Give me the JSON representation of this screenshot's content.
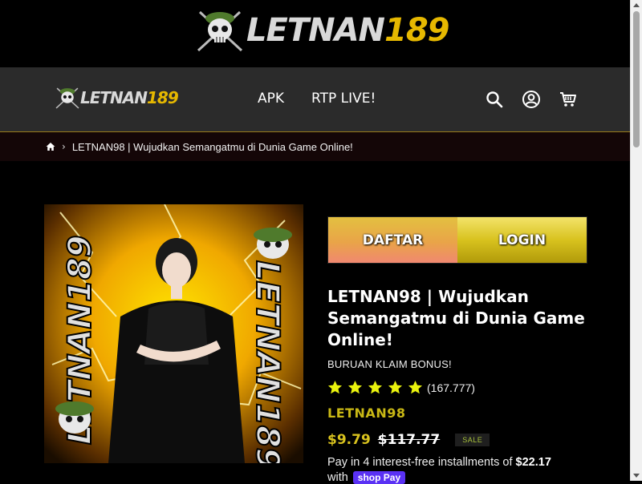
{
  "header": {
    "logo_text_white": "LETNAN",
    "logo_text_yellow": "189"
  },
  "nav": {
    "logo_text_white": "LETNAN",
    "logo_text_yellow": "189",
    "links": [
      {
        "label": "APK"
      },
      {
        "label": "RTP LIVE!"
      }
    ],
    "icons": [
      "search-icon",
      "account-icon",
      "cart-icon"
    ]
  },
  "breadcrumb": {
    "separator": "›",
    "current": "LETNAN98 | Wujudkan Semangatmu di Dunia Game Online!"
  },
  "product": {
    "image": {
      "side_text": "LETNAN189"
    },
    "auth": {
      "daftar_label": "DAFTAR",
      "login_label": "LOGIN"
    },
    "title": "LETNAN98 | Wujudkan Semangatmu di Dunia Game Online!",
    "subtitle": "BURUAN KLAIM BONUS!",
    "rating": {
      "stars": 5,
      "count": "(167.777)"
    },
    "vendor": "LETNAN98",
    "price": "$9.79",
    "compare_price": "$117.77",
    "sale_badge": "SALE",
    "installments_text": "Pay in 4 interest-free installments of ",
    "installments_amount": "$22.17",
    "with_text": "with",
    "shop_pay": "shop Pay"
  },
  "colors": {
    "accent_yellow": "#d8c21e",
    "star_yellow": "#e9f20d",
    "nav_bg": "#2b2b2b",
    "shop_pay": "#5a31f4"
  }
}
